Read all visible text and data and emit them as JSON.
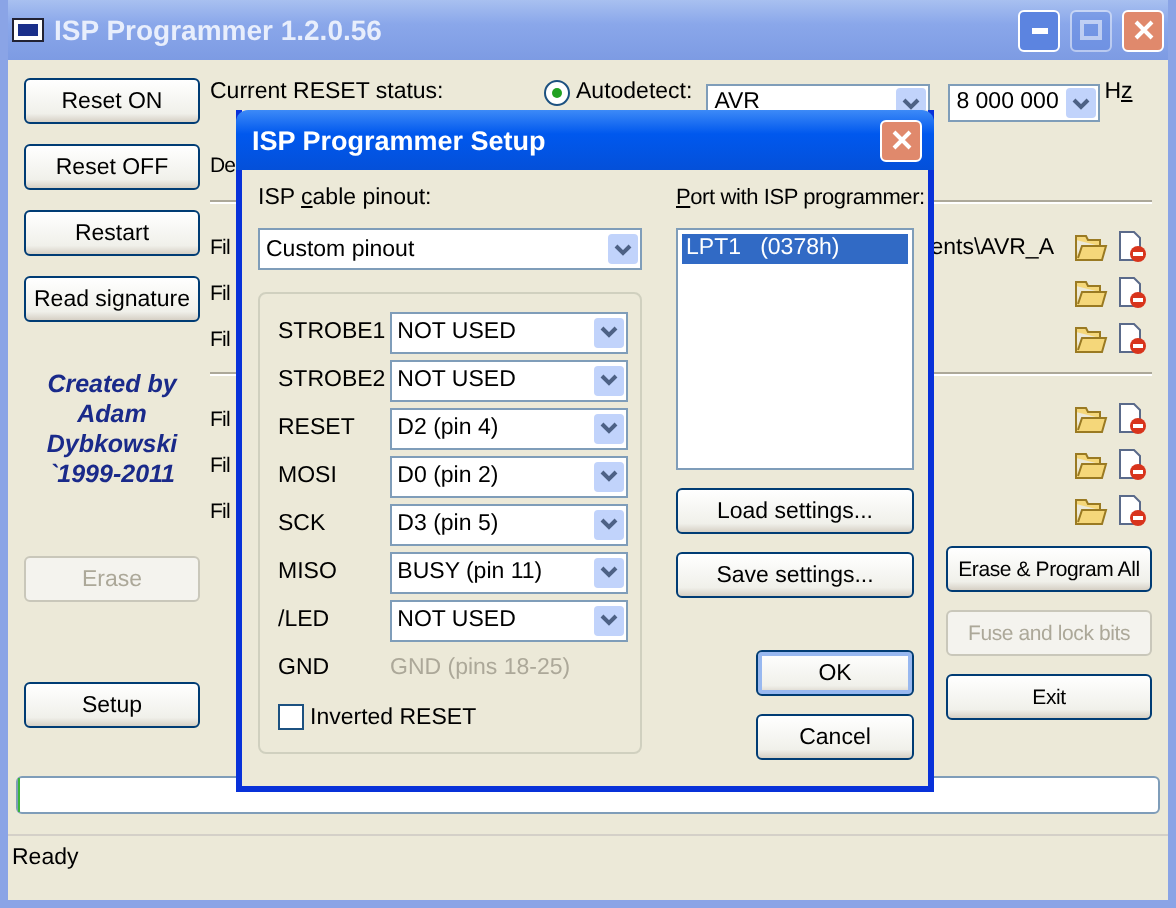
{
  "window": {
    "title": "ISP Programmer 1.2.0.56",
    "maximize_disabled": true
  },
  "left_buttons": [
    {
      "label": "Reset ON",
      "disabled": false
    },
    {
      "label": "Reset OFF",
      "disabled": false
    },
    {
      "label": "Restart",
      "disabled": false
    },
    {
      "label": "Read signature",
      "disabled": false
    }
  ],
  "credit": "Created by\nAdam\nDybkowski\n`1999-2011",
  "erase_button": {
    "label": "Erase",
    "disabled": true
  },
  "setup_button": {
    "label": "Setup",
    "disabled": false
  },
  "reset_status": {
    "label": "Current RESET status:"
  },
  "autodetect": {
    "label": "Autodetect:",
    "selected": true
  },
  "device_combo": {
    "value": "AVR"
  },
  "frequency": {
    "value": "8 000 000",
    "unit": "Hz"
  },
  "second_line_label": "De",
  "file_groups": [
    {
      "rows": [
        {
          "label": "Fil",
          "path": "ents\\AVR_A"
        },
        {
          "label": "Fil"
        },
        {
          "label": "Fil"
        }
      ]
    },
    {
      "rows": [
        {
          "label": "Fil"
        },
        {
          "label": "Fil"
        },
        {
          "label": "Fil"
        }
      ]
    }
  ],
  "right_buttons": [
    {
      "label": "Erase & Program All",
      "disabled": false
    },
    {
      "label": "Fuse and lock bits",
      "disabled": true
    },
    {
      "label": "Exit",
      "disabled": false
    }
  ],
  "progress": {
    "level": 0
  },
  "status_bar": {
    "text": "Ready"
  },
  "dialog": {
    "title": "ISP Programmer Setup",
    "pinout_label": {
      "text": "ISP cable pinout:"
    },
    "pinout_combo": {
      "value": "Custom pinout"
    },
    "pins": [
      {
        "kind": "combo",
        "name": "STROBE1",
        "value": "NOT USED"
      },
      {
        "kind": "combo",
        "name": "STROBE2",
        "value": "NOT USED"
      },
      {
        "kind": "combo",
        "name": "RESET",
        "value": "D2 (pin 4)"
      },
      {
        "kind": "combo",
        "name": "MOSI",
        "value": "D0 (pin 2)"
      },
      {
        "kind": "combo",
        "name": "SCK",
        "value": "D3 (pin 5)"
      },
      {
        "kind": "combo",
        "name": "MISO",
        "value": "BUSY (pin 11)"
      },
      {
        "kind": "combo",
        "name": "/LED",
        "value": "NOT USED"
      },
      {
        "kind": "fixed",
        "name": "GND",
        "value": "GND (pins 18-25)"
      }
    ],
    "inverted_reset": {
      "label": "Inverted RESET",
      "checked": false
    },
    "port_label": {
      "text": "Port with ISP programmer:"
    },
    "ports": [
      {
        "label": "LPT1   (0378h)",
        "selected": true
      }
    ],
    "settings_buttons": [
      "Load settings...",
      "Save settings..."
    ],
    "ok_button": {
      "label": "OK",
      "default": true
    },
    "cancel_button": {
      "label": "Cancel"
    }
  }
}
